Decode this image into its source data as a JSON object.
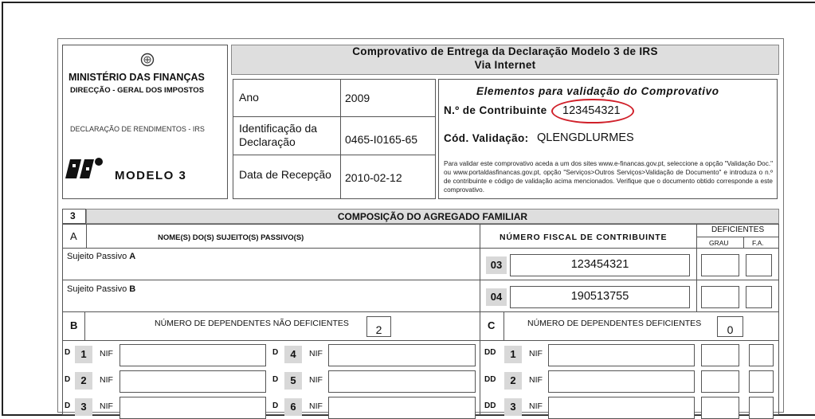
{
  "ministry": {
    "name": "MINISTÉRIO DAS FINANÇAS",
    "directorate": "DIRECÇÃO - GERAL DOS IMPOSTOS",
    "declaration_type": "DECLARAÇÃO DE RENDIMENTOS - IRS",
    "model": "MODELO 3"
  },
  "header": {
    "title_line1": "Comprovativo de Entrega da Declaração Modelo 3 de IRS",
    "title_line2": "Via Internet"
  },
  "info_rows": [
    {
      "label": "Ano",
      "value": "2009"
    },
    {
      "label_line1": "Identificação da",
      "label_line2": "Declaração",
      "value": "0465-I0165-65"
    },
    {
      "label": "Data de Recepção",
      "value": "2010-02-12"
    }
  ],
  "validation": {
    "title": "Elementos para validação do Comprovativo",
    "contribuinte_label": "N.º de Contribuinte",
    "contribuinte_value": "123454321",
    "codigo_label": "Cód. Validação:",
    "codigo_value": "QLENGDLURMES",
    "note": "Para validar este comprovativo aceda a um dos sites www.e-financas.gov.pt, seleccione a opção \"Validação Doc.\" ou www.portaldasfinancas.gov.pt, opção \"Serviços>Outros Serviços>Validação de Documento\" e introduza o n.º de contribuinte e código de validação acima mencionados. Verifique que o documento obtido corresponde a este comprovativo."
  },
  "section3": {
    "number": "3",
    "title": "COMPOSIÇÃO DO AGREGADO FAMILIAR",
    "col_a_letter": "A",
    "col_a_title": "NOME(S) DO(S) SUJEITO(S) PASSIVO(S)",
    "col_nif_title": "NÚMERO FISCAL DE CONTRIBUINTE",
    "deficientes": "DEFICIENTES",
    "grau": "GRAU",
    "fa": "F.A.",
    "passivo_a_label": "Sujeito Passivo",
    "passivo_a_letter": "A",
    "passivo_a_code": "03",
    "passivo_a_nif": "123454321",
    "passivo_b_label": "Sujeito Passivo",
    "passivo_b_letter": "B",
    "passivo_b_code": "04",
    "passivo_b_nif": "190513755",
    "b_letter": "B",
    "b_title": "NÚMERO DE DEPENDENTES NÃO DEFICIENTES",
    "b_value": "2",
    "c_letter": "C",
    "c_title": "NÚMERO DE DEPENDENTES DEFICIENTES",
    "c_value": "0",
    "nif_label": "NIF",
    "d_prefix": "D",
    "dd_prefix": "DD",
    "d_left": [
      "1",
      "2",
      "3"
    ],
    "d_mid": [
      "4",
      "5",
      "6"
    ],
    "dd_right": [
      "1",
      "2",
      "3"
    ]
  }
}
